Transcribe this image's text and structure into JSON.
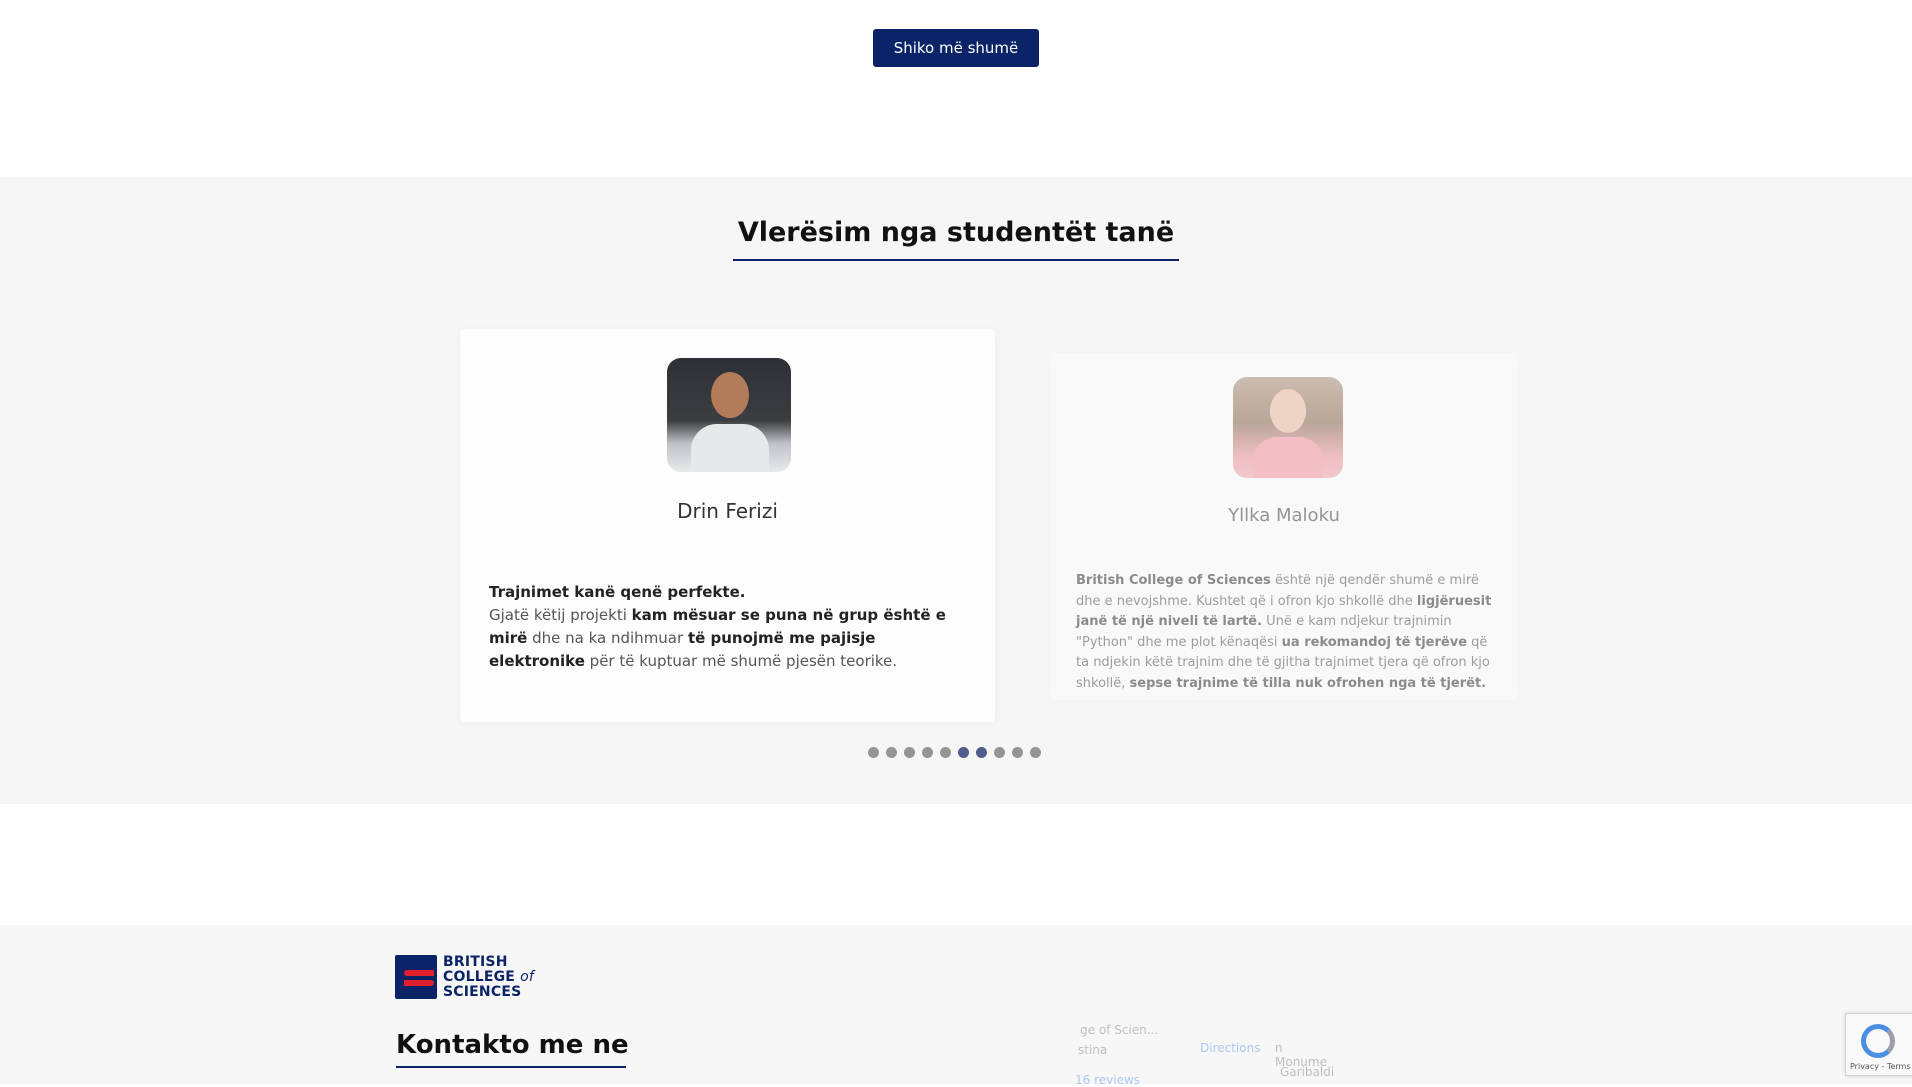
{
  "top": {
    "more_button": "Shiko më shumë"
  },
  "testimonials": {
    "title": "Vlerësim nga studentët tanë",
    "cards": [
      {
        "name": "Drin Ferizi",
        "quote": [
          {
            "b": "Trajnimet kanë qenë perfekte."
          },
          {
            "br": true
          },
          {
            "t": "Gjatë këtij projekti "
          },
          {
            "b": "kam mësuar se puna në grup është e mirë"
          },
          {
            "t": " dhe na ka ndihmuar "
          },
          {
            "b": "të punojmë me pajisje elektronike"
          },
          {
            "t": " për të kuptuar më shumë pjesën teorike."
          }
        ]
      },
      {
        "name": "Yllka Maloku",
        "quote": [
          {
            "b": "British College of Sciences"
          },
          {
            "t": " është një qendër shumë e mirë dhe e nevojshme. Kushtet që i ofron kjo shkollë dhe "
          },
          {
            "b": "ligjëruesit janë të një niveli të lartë."
          },
          {
            "t": " Unë e kam ndjekur trajnimin \"Python\" dhe me plot kënaqësi "
          },
          {
            "b": "ua rekomandoj të tjerëve"
          },
          {
            "t": " që ta ndjekin këtë trajnim dhe të gjitha trajnimet tjera që ofron kjo shkollë, "
          },
          {
            "b": "sepse trajnime të tilla nuk ofrohen nga të tjerët."
          }
        ]
      }
    ],
    "dots": {
      "count": 10,
      "active": [
        5,
        6
      ]
    }
  },
  "footer": {
    "logo": {
      "line1": "BRITISH",
      "line2": "COLLEGE",
      "line2_of": "of",
      "line3": "SCIENCES"
    },
    "contact_title": "Kontakto me ne",
    "map": {
      "place": "ge of Scien...",
      "directions": "Directions",
      "reviews": "16 reviews",
      "landmark": "n Monume",
      "street": "Garibaldi",
      "city": "stina"
    }
  },
  "recaptcha": {
    "text": "Privacy - Terms"
  },
  "colors": {
    "brand_navy": "#0b2468",
    "brand_red": "#e21f2d",
    "section_bg": "#f6f6f6",
    "dot_active": "#4f5d89"
  }
}
